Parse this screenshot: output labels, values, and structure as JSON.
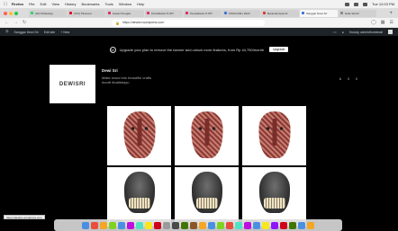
{
  "menubar": {
    "apple": "",
    "items": [
      "Firefox",
      "File",
      "Edit",
      "View",
      "History",
      "Bookmarks",
      "Tools",
      "Window",
      "Help"
    ],
    "clock": "Tue 12:03 PM"
  },
  "tabs": [
    {
      "label": "(20) WhatsApp",
      "color": "#25d366"
    },
    {
      "label": "(372) Pinterest",
      "color": "#e60023"
    },
    {
      "label": "Hasan Pengad",
      "color": "#e0245e"
    },
    {
      "label": "Pendaftaran P-IRT",
      "color": "#e0245e"
    },
    {
      "label": "Pendaftaran P-IRT",
      "color": "#e0245e"
    },
    {
      "label": "SISKA KBLI 2020",
      "color": "#3b6fd8"
    },
    {
      "label": "Beranda Upwork",
      "color": "#d33"
    },
    {
      "label": "Sanggar Dewi Sri",
      "color": "#3b6fd8",
      "active": true
    },
    {
      "label": "Hello World",
      "color": "#888"
    }
  ],
  "address": {
    "url": "https://shopmo.id/dewi-sri/mobile.html",
    "shown_url": "https://dewisri.wordpress.com"
  },
  "wpbar": {
    "site": "Sanggar Dewi Sri",
    "edit": "Edit site",
    "new": "+ New",
    "user": "Howdy, adminthumbnail"
  },
  "banner": {
    "text": "Upgrade your plan to remove the banner and unlock more features, from Rp 44,750/month",
    "button": "Upgrade"
  },
  "profile": {
    "logo_text": "DEWISRI",
    "name": "Dewi Sri",
    "bio_line1": "Make wood into beautiful crafts",
    "bio_line2": "#craft #batikbayu",
    "counts": [
      "6",
      "0",
      "0"
    ]
  },
  "posts": [
    {
      "kind": "red",
      "label": ""
    },
    {
      "kind": "red",
      "label": ""
    },
    {
      "kind": "red",
      "label": ""
    },
    {
      "kind": "gray",
      "label": "DEWISRI"
    },
    {
      "kind": "gray",
      "label": "DEWISRI"
    },
    {
      "kind": "gray",
      "label": "DEWISRI"
    }
  ],
  "status": "https://dewisri.wordpress.com",
  "dock_colors": [
    "#4a90e2",
    "#e94e3c",
    "#f5a623",
    "#7ed321",
    "#4a90e2",
    "#bd10e0",
    "#50e3c2",
    "#f8e71c",
    "#d0021b",
    "#9b9b9b",
    "#4a4a4a",
    "#417505",
    "#8b572a",
    "#f5a623",
    "#4a90e2",
    "#7ed321",
    "#e94e3c",
    "#50e3c2",
    "#bd10e0",
    "#4a90e2",
    "#f8e71c",
    "#9013fe",
    "#d0021b",
    "#417505",
    "#4a90e2",
    "#f5a623"
  ]
}
